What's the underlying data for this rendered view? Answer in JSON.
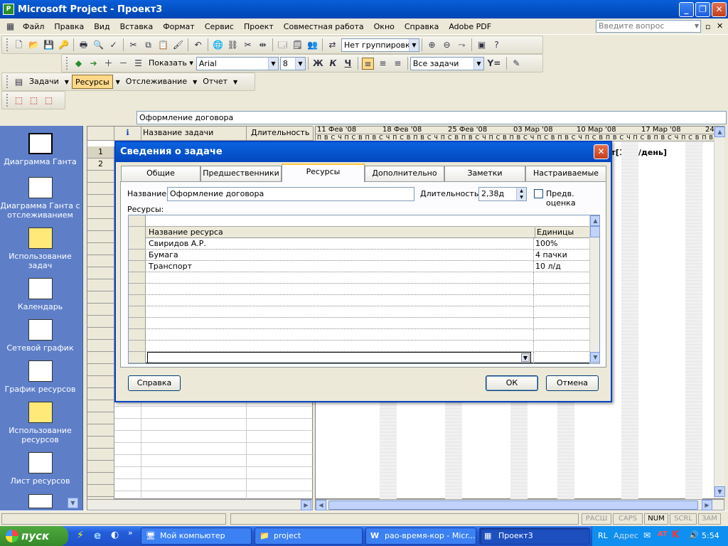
{
  "window": {
    "title": "Microsoft Project - Проект3",
    "icon": "ms-project-icon"
  },
  "menu": {
    "items": [
      "Файл",
      "Правка",
      "Вид",
      "Вставка",
      "Формат",
      "Сервис",
      "Проект",
      "Совместная работа",
      "Окно",
      "Справка",
      "Adobe PDF"
    ],
    "help_placeholder": "Введите вопрос"
  },
  "toolbar": {
    "grouping": "Нет группировки",
    "show_label": "Показать",
    "font": "Arial",
    "font_size": "8",
    "bold": "Ж",
    "italic": "К",
    "underline": "Ч",
    "filter": "Все задачи",
    "filter_icon": "Y="
  },
  "guide": {
    "tasks": "Задачи",
    "resources": "Ресурсы",
    "tracking": "Отслеживание",
    "report": "Отчет"
  },
  "entry": {
    "value": "Оформление договора"
  },
  "views": [
    "Диаграмма Ганта",
    "Диаграмма Ганта с отслеживанием",
    "Использование задач",
    "Календарь",
    "Сетевой график",
    "График ресурсов",
    "Использование ресурсов",
    "Лист ресурсов"
  ],
  "grid": {
    "col_name": "Название задачи",
    "col_duration": "Длительность",
    "rows": [
      "1",
      "2"
    ]
  },
  "gantt": {
    "weeks": [
      "11 Фев '08",
      "18 Фев '08",
      "25 Фев '08",
      "03 Мар '08",
      "10 Мар '08",
      "17 Мар '08",
      "24"
    ],
    "days": "ПВСЧПСВ",
    "bar_label": "орт[10 л/день]"
  },
  "dialog": {
    "title": "Сведения о задаче",
    "tabs": [
      "Общие",
      "Предшественники",
      "Ресурсы",
      "Дополнительно",
      "Заметки",
      "Настраиваемые поля"
    ],
    "name_label": "Название:",
    "name_value": "Оформление договора",
    "duration_label": "Длительность:",
    "duration_value": "2,38д",
    "estimated_label": "Предв. оценка",
    "resources_label": "Ресурсы:",
    "col_resource": "Название ресурса",
    "col_units": "Единицы",
    "resources": [
      {
        "name": "Свиридов А.Р.",
        "units": "100%"
      },
      {
        "name": "Бумага",
        "units": "4 пачки"
      },
      {
        "name": "Транспорт",
        "units": "10 л/д"
      }
    ],
    "help_button": "Справка",
    "ok_button": "ОК",
    "cancel_button": "Отмена"
  },
  "status": [
    "РАСШ",
    "CAPS",
    "NUM",
    "SCRL",
    "ЗАМ"
  ],
  "taskbar": {
    "start": "пуск",
    "tasks": [
      "Мой компьютер",
      "project",
      "рао-время-кор - Micr...",
      "Проект3"
    ],
    "lang": "RL",
    "address": "Адрес",
    "clock": "5:54"
  }
}
